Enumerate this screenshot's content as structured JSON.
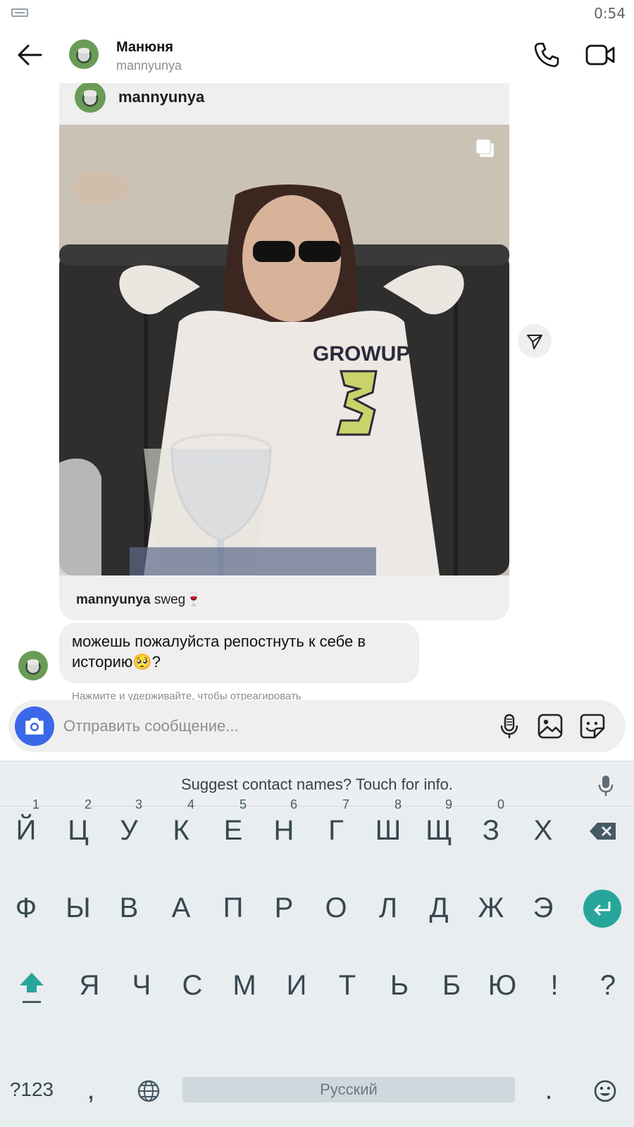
{
  "status_bar": {
    "time": "0:54",
    "icon": "keyboard-indicator-icon"
  },
  "header": {
    "name": "Манюня",
    "username": "mannyunya",
    "icons": [
      "back-arrow-icon",
      "phone-icon",
      "video-camera-icon"
    ]
  },
  "post": {
    "author": "mannyunya",
    "caption_user": "mannyunya",
    "caption_text": "sweg🍷",
    "icons": [
      "multiple-photos-icon",
      "share-icon"
    ]
  },
  "message": {
    "text": "можешь пожалуйста репостнуть к себе в историю🥺?"
  },
  "hint": "Нажмите и удерживайте, чтобы отреагировать",
  "composer": {
    "placeholder": "Отправить сообщение...",
    "icons": [
      "camera-icon",
      "microphone-icon",
      "gallery-icon",
      "sticker-icon"
    ]
  },
  "keyboard": {
    "suggestion": "Suggest contact names? Touch for info.",
    "row1": [
      "Й",
      "Ц",
      "У",
      "К",
      "Е",
      "Н",
      "Г",
      "Ш",
      "Щ",
      "З",
      "Х"
    ],
    "row1_hints": [
      "1",
      "2",
      "3",
      "4",
      "5",
      "6",
      "7",
      "8",
      "9",
      "0"
    ],
    "row2": [
      "Ф",
      "Ы",
      "В",
      "А",
      "П",
      "Р",
      "О",
      "Л",
      "Д",
      "Ж",
      "Э"
    ],
    "row3": [
      "Я",
      "Ч",
      "С",
      "М",
      "И",
      "Т",
      "Ь",
      "Б",
      "Ю",
      "!",
      "?"
    ],
    "symbols_label": "?123",
    "comma": ",",
    "space_label": "Русский",
    "period": ".",
    "accent_color": "#26a69a"
  },
  "colors": {
    "camera_button": "#3b68e8",
    "bubble": "#efefef"
  }
}
